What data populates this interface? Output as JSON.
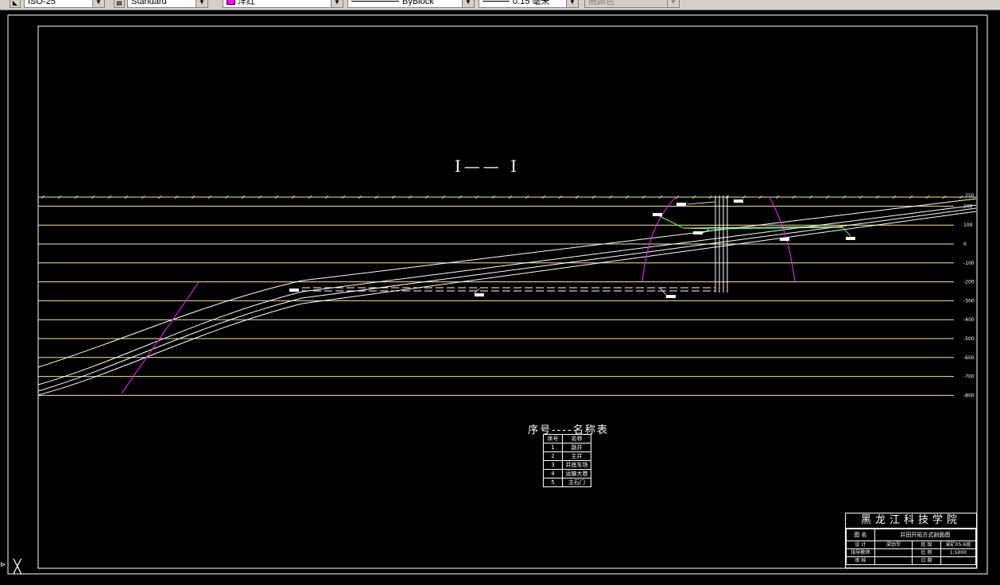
{
  "toolbar": {
    "dimstyle": "ISO-25",
    "textstyle": "Standard",
    "color": "洋红",
    "color_swatch": "#ff00ff",
    "linetype": "ByBlock",
    "lineweight": "0.15 毫米",
    "plotstyle": "随颜色"
  },
  "drawing": {
    "section_title": "I—— I",
    "elevation_labels": [
      "200",
      "100",
      "0",
      "-100",
      "-200",
      "-300",
      "-400",
      "-500",
      "-600",
      "-700",
      "-800"
    ],
    "elevation_top_label": "250",
    "colors": {
      "frame": "#ffffff",
      "grid": "#f5e6a0",
      "seams": "#ffffff",
      "fault": "#e020e0",
      "roadway": "#ffffff",
      "tunnel_green": "#60ff60"
    }
  },
  "name_table": {
    "title": "序号----名称表",
    "header": [
      "序号",
      "名称"
    ],
    "rows": [
      [
        "1",
        "副井"
      ],
      [
        "2",
        "主井"
      ],
      [
        "3",
        "井底车场"
      ],
      [
        "4",
        "运输大巷"
      ],
      [
        "5",
        "主石门"
      ]
    ]
  },
  "title_block": {
    "school": "黑龙江科技学院",
    "rows": [
      [
        "图 名",
        "井田开拓方式剖面图",
        "",
        ""
      ],
      [
        "设 计",
        "梁劲军",
        "班 级",
        "采矿05-6班"
      ],
      [
        "指导教师",
        "",
        "比 例",
        "1:5000"
      ],
      [
        "审 核",
        "",
        "日 期",
        ""
      ]
    ]
  }
}
